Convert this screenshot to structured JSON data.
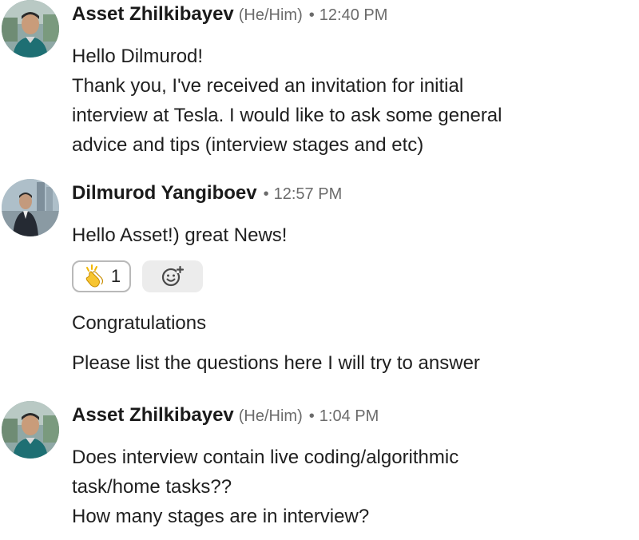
{
  "messages": [
    {
      "sender": "Asset Zhilkibayev",
      "pronouns": "(He/Him)",
      "separator": "•",
      "time": "12:40 PM",
      "lines": [
        "Hello Dilmurod!",
        "Thank you, I've received an invitation for initial",
        "interview at Tesla. I would like to ask some general",
        "advice and tips (interview stages and etc)"
      ]
    },
    {
      "sender": "Dilmurod Yangiboev",
      "separator": "•",
      "time": "12:57 PM",
      "lines": [
        "Hello Asset!) great News!"
      ],
      "reactions": [
        {
          "emoji": "clapping-hands-icon",
          "count": "1"
        },
        {
          "emoji": "add-reaction-icon"
        }
      ],
      "followups": [
        "Congratulations",
        "Please list the questions here I will try to answer"
      ]
    },
    {
      "sender": "Asset Zhilkibayev",
      "pronouns": "(He/Him)",
      "separator": "•",
      "time": "1:04 PM",
      "lines": [
        "Does interview contain live coding/algorithmic",
        "task/home tasks??",
        "How many stages are in interview?"
      ]
    }
  ],
  "colors": {
    "name": "#1a1a1a",
    "meta": "#6b6b6b",
    "text": "#1f1f1f",
    "reaction_border": "#b9b9b9",
    "reaction_add_bg": "#ececec"
  }
}
